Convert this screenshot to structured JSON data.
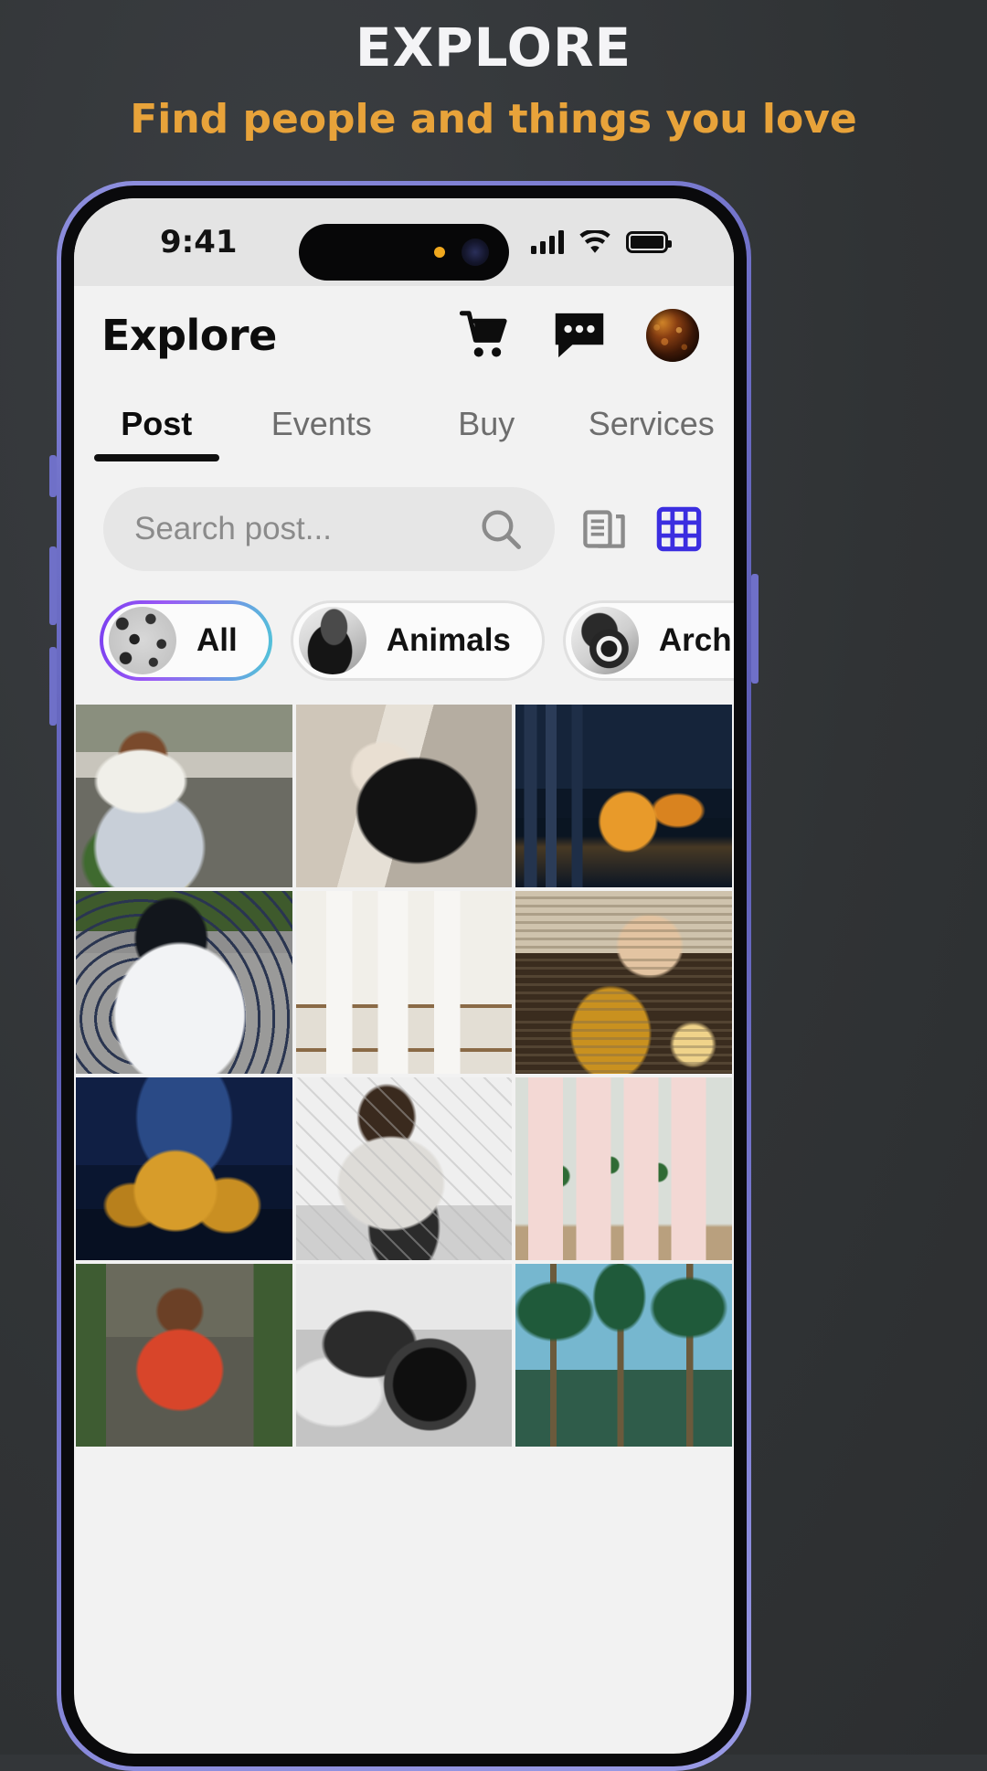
{
  "promo": {
    "title": "EXPLORE",
    "subtitle": "Find people and things you love",
    "title_color": "#f4f4f6",
    "subtitle_color": "#e8a33a",
    "background_color": "#333639"
  },
  "phone": {
    "bezel_color": "#6f70c8",
    "frame_color": "#0a0a0c"
  },
  "status_bar": {
    "time": "9:41",
    "icons": [
      "cellular-signal-icon",
      "wifi-icon",
      "battery-icon"
    ],
    "dynamic_island": true
  },
  "app_header": {
    "title": "Explore",
    "actions": [
      {
        "name": "cart-icon"
      },
      {
        "name": "chat-bubble-icon"
      },
      {
        "name": "profile-avatar"
      }
    ]
  },
  "tabs": {
    "active": "Post",
    "items": [
      {
        "label": "Post",
        "active": true
      },
      {
        "label": "Events",
        "active": false
      },
      {
        "label": "Buy",
        "active": false
      },
      {
        "label": "Services",
        "active": false
      }
    ]
  },
  "search": {
    "placeholder": "Search post...",
    "value": "",
    "icon": "search-icon",
    "view_toggles": [
      {
        "name": "list-view-icon",
        "color": "#8b8b8b",
        "active": false
      },
      {
        "name": "grid-view-icon",
        "color": "#3b2ee0",
        "active": true
      }
    ]
  },
  "filter_chips": {
    "selected": "All",
    "selected_border_gradient": [
      "#7a3ff0",
      "#4fc6d8"
    ],
    "items": [
      {
        "label": "All",
        "thumb": "thumb-all",
        "selected": true
      },
      {
        "label": "Animals",
        "thumb": "thumb-animals",
        "selected": false
      },
      {
        "label": "Architecture",
        "thumb": "thumb-arch",
        "selected": false
      }
    ]
  },
  "photo_grid": {
    "columns": 3,
    "cells": [
      {
        "name": "post-thumbnail-woman-bicycle-flowers",
        "scene": "s-bike"
      },
      {
        "name": "post-thumbnail-woman-black-dress",
        "scene": "s-dress"
      },
      {
        "name": "post-thumbnail-city-skyline-night",
        "scene": "s-city"
      },
      {
        "name": "post-thumbnail-polka-dot-dress",
        "scene": "s-polka"
      },
      {
        "name": "post-thumbnail-white-candles-shelf",
        "scene": "s-candles"
      },
      {
        "name": "post-thumbnail-elderly-man-dinner",
        "scene": "s-man"
      },
      {
        "name": "post-thumbnail-palace-fine-arts-night",
        "scene": "s-palace"
      },
      {
        "name": "post-thumbnail-woman-cooking-kitchen",
        "scene": "s-cook"
      },
      {
        "name": "post-thumbnail-pink-leaf-napkins",
        "scene": "s-napkin"
      },
      {
        "name": "post-thumbnail-delivery-man-backpack",
        "scene": "s-delivery"
      },
      {
        "name": "post-thumbnail-hands-holding-camera",
        "scene": "s-camera"
      },
      {
        "name": "post-thumbnail-palm-trees-sky",
        "scene": "s-palms"
      }
    ]
  }
}
